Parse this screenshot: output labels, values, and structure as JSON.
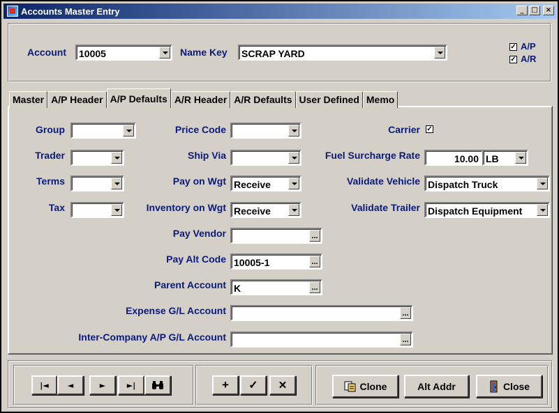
{
  "window": {
    "title": "Accounts Master Entry",
    "minimize": "_",
    "maximize": "□",
    "close": "×"
  },
  "header": {
    "account_label": "Account",
    "account_value": "10005",
    "namekey_label": "Name Key",
    "namekey_value": "SCRAP YARD",
    "ap_label": "A/P",
    "ar_label": "A/R",
    "ap_checked": true,
    "ar_checked": true
  },
  "tabs": [
    "Master",
    "A/P Header",
    "A/P Defaults",
    "A/R Header",
    "A/R Defaults",
    "User Defined",
    "Memo"
  ],
  "active_tab": "A/P Defaults",
  "form": {
    "group_label": "Group",
    "group_value": "",
    "trader_label": "Trader",
    "trader_value": "",
    "terms_label": "Terms",
    "terms_value": "",
    "tax_label": "Tax",
    "tax_value": "",
    "price_code_label": "Price Code",
    "price_code_value": "",
    "ship_via_label": "Ship Via",
    "ship_via_value": "",
    "pay_on_wgt_label": "Pay on Wgt",
    "pay_on_wgt_value": "Receive",
    "inv_on_wgt_label": "Inventory on Wgt",
    "inv_on_wgt_value": "Receive",
    "pay_vendor_label": "Pay Vendor",
    "pay_vendor_value": "",
    "pay_alt_code_label": "Pay Alt Code",
    "pay_alt_code_value": "10005-1",
    "parent_account_label": "Parent Account",
    "parent_account_value": "K",
    "expense_gl_label": "Expense G/L Account",
    "expense_gl_value": "",
    "intercompany_label": "Inter-Company A/P G/L Account",
    "intercompany_value": "",
    "carrier_label": "Carrier",
    "carrier_checked": true,
    "fuel_label": "Fuel Surcharge Rate",
    "fuel_value": "10.00",
    "fuel_unit": "LB",
    "validate_vehicle_label": "Validate Vehicle",
    "validate_vehicle_value": "Dispatch Truck",
    "validate_trailer_label": "Validate Trailer",
    "validate_trailer_value": "Dispatch Equipment",
    "ellipsis": "..."
  },
  "footer": {
    "first": "|◄",
    "prev": "◄",
    "next": "►",
    "last": "►|",
    "find_icon": "binoculars-icon",
    "add": "+",
    "save": "✓",
    "cancel": "✕",
    "clone_label": "Clone",
    "alt_addr_label": "Alt Addr",
    "close_label": "Close"
  }
}
